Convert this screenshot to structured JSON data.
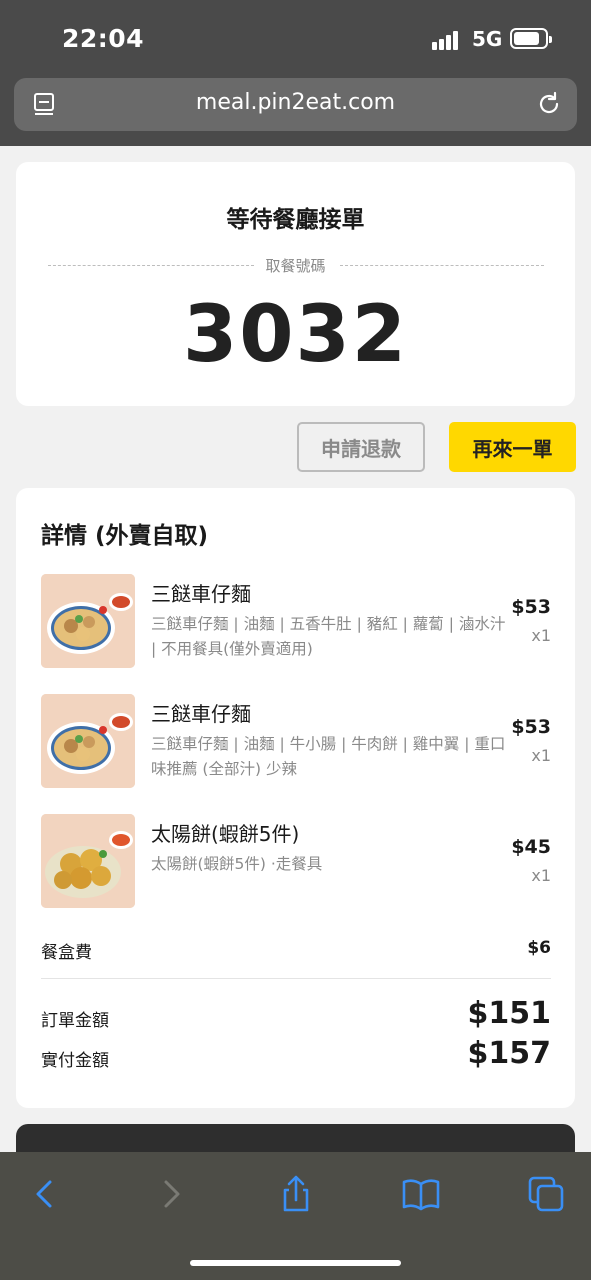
{
  "status_bar": {
    "time": "22:04",
    "network": "5G"
  },
  "browser": {
    "url": "meal.pin2eat.com"
  },
  "order_status": {
    "title": "等待餐廳接單",
    "pickup_label": "取餐號碼",
    "pickup_number": "3032"
  },
  "actions": {
    "refund_label": "申請退款",
    "reorder_label": "再來一單"
  },
  "details": {
    "title": "詳情 (外賣自取)",
    "items": [
      {
        "name": "三餸車仔麵",
        "desc": "三餸車仔麵 | 油麵 | 五香牛肚 | 豬紅 | 蘿蔔 | 滷水汁 | 不用餐具(僅外賣適用)",
        "price": "$53",
        "qty": "x1",
        "image": "noodle-bowl-image"
      },
      {
        "name": "三餸車仔麵",
        "desc": "三餸車仔麵 | 油麵 | 牛小腸 | 牛肉餅 | 雞中翼 | 重口味推薦 (全部汁) 少辣",
        "price": "$53",
        "qty": "x1",
        "image": "noodle-bowl-image"
      },
      {
        "name": "太陽餅(蝦餅5件)",
        "desc": "太陽餅(蝦餅5件) ·走餐具",
        "price": "$45",
        "qty": "x1",
        "image": "shrimp-cake-image"
      }
    ],
    "box_fee_label": "餐盒費",
    "box_fee": "$6",
    "order_total_label": "訂單金額",
    "order_total": "$151",
    "paid_label": "實付金額",
    "paid": "$157"
  },
  "colors": {
    "accent": "#ffd800",
    "chrome": "#4a4a4a",
    "ios_blue": "#3a8ff5"
  }
}
